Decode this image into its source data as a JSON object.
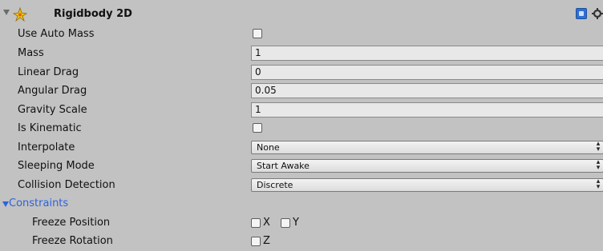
{
  "component": {
    "title": "Rigidbody 2D",
    "icon": "rigidbody2d-icon",
    "help_icon": "help-book-icon",
    "settings_icon": "gear-icon"
  },
  "fields": {
    "use_auto_mass": {
      "label": "Use Auto Mass",
      "checked": false
    },
    "mass": {
      "label": "Mass",
      "value": "1"
    },
    "linear_drag": {
      "label": "Linear Drag",
      "value": "0"
    },
    "angular_drag": {
      "label": "Angular Drag",
      "value": "0.05"
    },
    "gravity_scale": {
      "label": "Gravity Scale",
      "value": "1"
    },
    "is_kinematic": {
      "label": "Is Kinematic",
      "checked": false
    },
    "interpolate": {
      "label": "Interpolate",
      "value": "None"
    },
    "sleeping_mode": {
      "label": "Sleeping Mode",
      "value": "Start Awake"
    },
    "collision_detection": {
      "label": "Collision Detection",
      "value": "Discrete"
    }
  },
  "constraints": {
    "label": "Constraints",
    "freeze_position": {
      "label": "Freeze Position",
      "x_label": "X",
      "y_label": "Y"
    },
    "freeze_rotation": {
      "label": "Freeze Rotation",
      "z_label": "Z"
    }
  },
  "colors": {
    "background": "#c2c2c2",
    "accent_blue": "#2b63e0"
  }
}
